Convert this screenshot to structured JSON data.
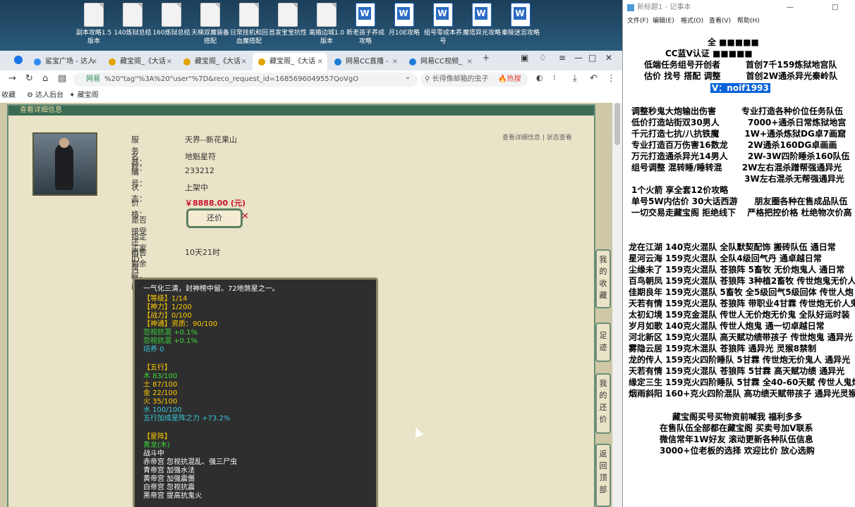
{
  "desktop": {
    "icons": [
      {
        "label": "副本攻略1.5版本",
        "type": "doc"
      },
      {
        "label": "140炼狱总结",
        "type": "doc"
      },
      {
        "label": "160炼狱总结",
        "type": "doc"
      },
      {
        "label": "天梯双魔装备搭配",
        "type": "doc"
      },
      {
        "label": "日常挂机和回血魔搭配",
        "type": "doc"
      },
      {
        "label": "首发宝宝抗性",
        "type": "doc"
      },
      {
        "label": "离婚边城1.0版本",
        "type": "doc"
      },
      {
        "label": "新老孩子养成攻略",
        "type": "word"
      },
      {
        "label": "月10E攻略",
        "type": "word"
      },
      {
        "label": "组号零成本养号",
        "type": "word"
      },
      {
        "label": "魔塔异光攻略",
        "type": "word"
      },
      {
        "label": "秦陵迷宫攻略",
        "type": "word"
      }
    ]
  },
  "browser": {
    "tabs": [
      {
        "label": "鲨宝广场 - 达人"
      },
      {
        "label": "藏宝阁_《大话"
      },
      {
        "label": "藏宝阁_《大话"
      },
      {
        "label": "藏宝阁_《大话"
      },
      {
        "label": "网易CC直播 -"
      },
      {
        "label": "网易CC视频_"
      }
    ],
    "url_site": "网易",
    "url": "%20\"tag\"%3A%20\"user\"%7D&reco_request_id=1685696049557QoVgO",
    "search_placeholder": "长得像邮箱的虫子",
    "hot_label": "热搜",
    "bookmarks": [
      "收藏",
      "达人后台",
      "藏宝阁"
    ],
    "panel_header": "查看详细信息",
    "top_right_links": "查看详细信息 | 状态查看",
    "fields": [
      {
        "key": "服 务 器：",
        "value": "天界--新花果山"
      },
      {
        "key": "名　　称：",
        "value": "地魁星符"
      },
      {
        "key": "编　　号：",
        "value": "233212"
      },
      {
        "key": "状　　态：",
        "value": "上架中"
      },
      {
        "key": "价　　格：",
        "value": "￥8888.00 (元)"
      },
      {
        "key": "是否接受还价：",
        "value": ""
      },
      {
        "key": "指定买家 ID：",
        "value": ""
      },
      {
        "key": "出售剩余时间：",
        "value": "10天21时"
      },
      {
        "key": "属性：",
        "value": ""
      }
    ],
    "bargain_label": "还价",
    "attr_lines": [
      {
        "text": "一气化三清，封神榜中留。72地煞星之一。",
        "color": "w"
      },
      {
        "text": "【等级】1/14",
        "color": "y"
      },
      {
        "text": "【神力】1/200",
        "color": "y"
      },
      {
        "text": "【战力】0/100",
        "color": "y"
      },
      {
        "text": "【神通】资质：90/100",
        "color": "y"
      },
      {
        "text": "忽视抗混 +0.1%",
        "color": "g"
      },
      {
        "text": "忽视抗混 +0.1%",
        "color": "g"
      },
      {
        "text": "培养 0",
        "color": "c"
      },
      {
        "text": "",
        "color": "w"
      },
      {
        "text": "【五行】",
        "color": "y"
      },
      {
        "text": "木 83/100",
        "color": "g"
      },
      {
        "text": "土 87/100",
        "color": "y"
      },
      {
        "text": "金 22/100",
        "color": "y"
      },
      {
        "text": "火 35/100",
        "color": "y"
      },
      {
        "text": "水 100/100",
        "color": "c"
      },
      {
        "text": "五行加成星阵之力 +73.2%",
        "color": "c"
      },
      {
        "text": "",
        "color": "w"
      },
      {
        "text": "【星阵】",
        "color": "y"
      },
      {
        "text": "青龙(木)",
        "color": "g"
      },
      {
        "text": "战斗中",
        "color": "w"
      },
      {
        "text": "赤帝宫 忽视抗混乱、强三尸虫",
        "color": "w"
      },
      {
        "text": "青帝宫 加强水法",
        "color": "w"
      },
      {
        "text": "黄帝宫 加强震慑",
        "color": "w"
      },
      {
        "text": "白帝宫 忽视抗震",
        "color": "w"
      },
      {
        "text": "黑帝宫 提高抗鬼火",
        "color": "w"
      }
    ],
    "side_buttons": [
      "我的收藏",
      "足迹",
      "我的还价",
      "返回顶部"
    ]
  },
  "notepad": {
    "title": "新标题1 - 记事本",
    "menu": [
      "文件(F)",
      "编辑(E)",
      "格式(O)",
      "查看(V)",
      "帮助(H)"
    ],
    "header_lines": [
      "全 ■■■■■",
      "CC蓝V认证 ■■■■■",
      "低端任务组号开创者　　　首创7千159炼狱地宫队",
      "估价 找号 搭配 调整　　　首创2W通杀异光秦岭队"
    ],
    "contact": "V：noif1993",
    "block1": [
      "调整秒鬼大炮输出伤害　　　专业打造各种价位任务队伍",
      "低价打造站街双30男人　　　 7000+通杀日常炼狱地宫",
      "千元打造七抗/八抗铁魔　　　1W+通杀炼狱DG卓7画窟",
      "专业打造百万伤害16数龙　　  2W通杀160DG卓画画",
      "万元打造通杀异光14男人　　 2W-3W四阶睡杀160队伍",
      "组号调整 混转睡/睡转混　　  2W左右混杀蹭帮强通异光",
      "　　　　　　　　　　　　　  3W左右混杀无帮强通异光"
    ],
    "block2": [
      "1个火箭 享全套12价攻略",
      "单号5W内估价 30大话西游　　朋友圈各种在售成品队伍",
      "一切交易走藏宝阁 拒绝线下　 严格把控价格 杜绝物次价高"
    ],
    "block3": [
      "龙在江湖 140克火混队 全队默契配饰 搬砖队伍 通日常",
      "星河云海 159克火混队 全队4级回气丹 通卓越日常",
      "尘缘未了 159克火混队 苍狼阵 5畜牧 无价炮鬼人 通日常",
      "百鸟朝凤 159克火混队 苍狼阵 3种植2畜牧 传世炮鬼无价人",
      "佳期良年 159克火混队 5畜牧 全5级回气5级回体 传世人炮",
      "天若有情 159克火混队 苍狼阵 带职业4甘霖 传世炮无价人鬼",
      "太初幻境 159克金混队 传世人无价炮无价鬼 全队好运时装",
      "岁月如歌 140克火混队 传世人炮鬼 通一切卓越日常",
      "河北新区 159克火混队 高天赋功绩带孩子 传世炮鬼 通异光",
      "雾隐云居 159克木混队 苍狼阵 通异光 灵猴8禁制",
      "龙的传人 159克火四阶睡队 5甘霖 传世炮无价鬼人 通异光",
      "天若有情 159克火混队 苍狼阵 5甘霖 高天赋功绩 通异光",
      "缘定三生 159克火四阶睡队 5甘霖 全40-60天赋 传世人鬼炮",
      "烟雨斜阳 160+克火四阶混队 高功绩天赋带孩子 通异光灵猴"
    ],
    "block4": [
      "藏宝阁买号买物资前喊我 福利多多",
      "在售队伍全部都在藏宝阁 买卖号加V联系",
      "微信常年1W好友 滚动更新各种队伍信息",
      "3000+位老板的选择 欢迎比价 放心选购"
    ]
  }
}
